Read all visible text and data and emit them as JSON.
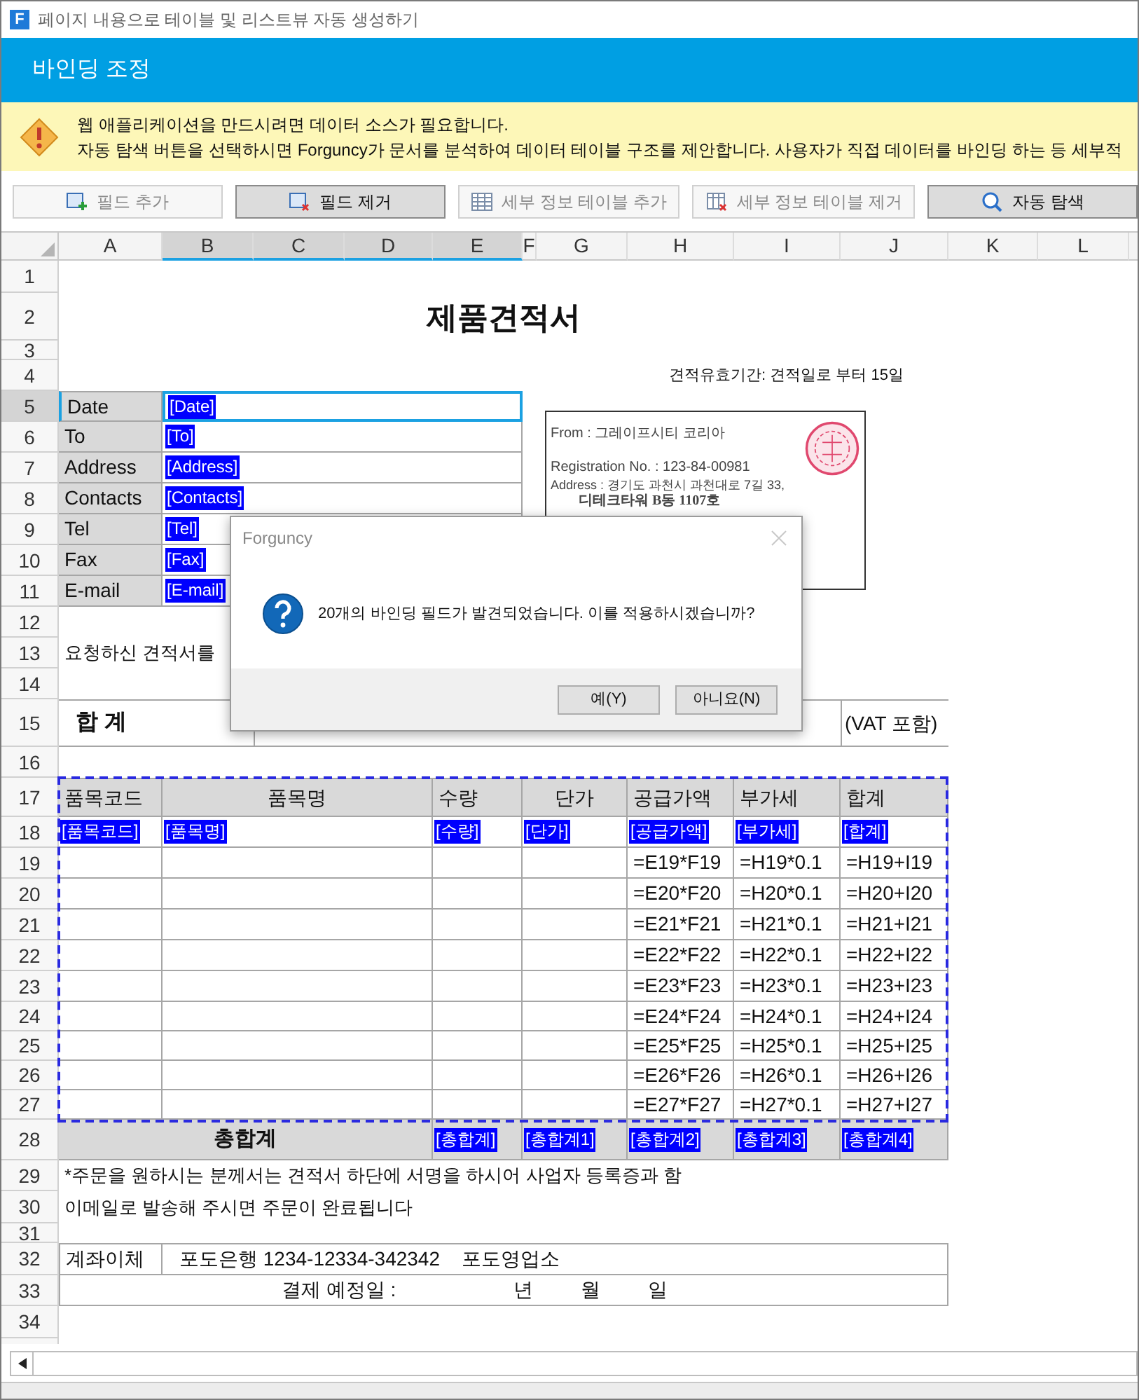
{
  "window": {
    "title": "페이지 내용으로 테이블 및 리스트뷰 자동 생성하기",
    "logo": "F"
  },
  "header": {
    "title": "바인딩 조정"
  },
  "warning": {
    "lines": [
      "웹 애플리케이션을 만드시려면 데이터 소스가 필요합니다.",
      "자동 탐색 버튼을 선택하시면 Forguncy가 문서를 분석하여 데이터 테이블 구조를 제안합니다. 사용자가 직접 데이터를 바인딩 하는 등 세부적"
    ]
  },
  "toolbar": [
    {
      "kind": "field-add",
      "label": "필드 추가",
      "disabled": true
    },
    {
      "kind": "field-remove",
      "label": "필드 제거",
      "disabled": false
    },
    {
      "kind": "table-add",
      "label": "세부 정보 테이블 추가",
      "disabled": true
    },
    {
      "kind": "table-remove",
      "label": "세부 정보 테이블 제거",
      "disabled": true
    },
    {
      "kind": "search",
      "label": "자동 탐색",
      "disabled": false
    }
  ],
  "columns": [
    {
      "label": "A",
      "selected": false
    },
    {
      "label": "B",
      "selected": true
    },
    {
      "label": "C",
      "selected": true
    },
    {
      "label": "D",
      "selected": true
    },
    {
      "label": "E",
      "selected": true
    },
    {
      "label": "F",
      "selected": false
    },
    {
      "label": "G",
      "selected": false
    },
    {
      "label": "H",
      "selected": false
    },
    {
      "label": "I",
      "selected": false
    },
    {
      "label": "J",
      "selected": false
    },
    {
      "label": "K",
      "selected": false
    },
    {
      "label": "L",
      "selected": false
    }
  ],
  "rows": [
    {
      "label": "1",
      "selected": false
    },
    {
      "label": "2",
      "selected": false
    },
    {
      "label": "3",
      "selected": false
    },
    {
      "label": "4",
      "selected": false
    },
    {
      "label": "5",
      "selected": true
    },
    {
      "label": "6",
      "selected": false
    },
    {
      "label": "7",
      "selected": false
    },
    {
      "label": "8",
      "selected": false
    },
    {
      "label": "9",
      "selected": false
    },
    {
      "label": "10",
      "selected": false
    },
    {
      "label": "11",
      "selected": false
    },
    {
      "label": "12",
      "selected": false
    },
    {
      "label": "13",
      "selected": false
    },
    {
      "label": "14",
      "selected": false
    },
    {
      "label": "15",
      "selected": false
    },
    {
      "label": "16",
      "selected": false
    },
    {
      "label": "17",
      "selected": false
    },
    {
      "label": "18",
      "selected": false
    },
    {
      "label": "19",
      "selected": false
    },
    {
      "label": "20",
      "selected": false
    },
    {
      "label": "21",
      "selected": false
    },
    {
      "label": "22",
      "selected": false
    },
    {
      "label": "23",
      "selected": false
    },
    {
      "label": "24",
      "selected": false
    },
    {
      "label": "25",
      "selected": false
    },
    {
      "label": "26",
      "selected": false
    },
    {
      "label": "27",
      "selected": false
    },
    {
      "label": "28",
      "selected": false
    },
    {
      "label": "29",
      "selected": false
    },
    {
      "label": "30",
      "selected": false
    },
    {
      "label": "31",
      "selected": false
    },
    {
      "label": "32",
      "selected": false
    },
    {
      "label": "33",
      "selected": false
    },
    {
      "label": "34",
      "selected": false
    }
  ],
  "sheet": {
    "title": "제품견적서",
    "validity": "견적유효기간: 견적일로 부터 15일",
    "info_fields": [
      {
        "label": "Date",
        "binding": "[Date]",
        "selected": true
      },
      {
        "label": "To",
        "binding": "[To]",
        "selected": false
      },
      {
        "label": "Address",
        "binding": "[Address]",
        "selected": false
      },
      {
        "label": "Contacts",
        "binding": "[Contacts]",
        "selected": false
      },
      {
        "label": "Tel",
        "binding": "[Tel]",
        "selected": false
      },
      {
        "label": "Fax",
        "binding": "[Fax]",
        "selected": false
      },
      {
        "label": "E-mail",
        "binding": "[E-mail]",
        "selected": false
      }
    ],
    "company_card": {
      "from": "From : 그레이프시티 코리아",
      "registration": "Registration No. : 123-84-00981",
      "address": "Address : 경기도 과천시 과천대로 7길 33,",
      "address_2": "디테크타워 B동 1107호"
    },
    "request_text": "요청하신 견적서를",
    "total_row": {
      "label": "합 계",
      "note": "(VAT 포함)"
    },
    "items_table": {
      "columns": [
        {
          "header": "품목코드",
          "binding": "[품목코드]"
        },
        {
          "header": "품목명",
          "binding": "[품목명]"
        },
        {
          "header": "수량",
          "binding": "[수량]"
        },
        {
          "header": "단가",
          "binding": "[단가]"
        },
        {
          "header": "공급가액",
          "binding": "[공급가액]"
        },
        {
          "header": "부가세",
          "binding": "[부가세]"
        },
        {
          "header": "합계",
          "binding": "[합계]"
        }
      ],
      "rows": [
        {
          "supply": "=E19*F19",
          "vat": "=H19*0.1",
          "total": "=H19+I19"
        },
        {
          "supply": "=E20*F20",
          "vat": "=H20*0.1",
          "total": "=H20+I20"
        },
        {
          "supply": "=E21*F21",
          "vat": "=H21*0.1",
          "total": "=H21+I21"
        },
        {
          "supply": "=E22*F22",
          "vat": "=H22*0.1",
          "total": "=H22+I22"
        },
        {
          "supply": "=E23*F23",
          "vat": "=H23*0.1",
          "total": "=H23+I23"
        },
        {
          "supply": "=E24*F24",
          "vat": "=H24*0.1",
          "total": "=H24+I24"
        },
        {
          "supply": "=E25*F25",
          "vat": "=H25*0.1",
          "total": "=H25+I25"
        },
        {
          "supply": "=E26*F26",
          "vat": "=H26*0.1",
          "total": "=H26+I26"
        },
        {
          "supply": "=E27*F27",
          "vat": "=H27*0.1",
          "total": "=H27+I27"
        }
      ],
      "grand_total": {
        "label": "총합계",
        "bindings": [
          "[총합계]",
          "[총합계1]",
          "[총합계2]",
          "[총합계3]",
          "[총합계4]"
        ]
      }
    },
    "notes": [
      "*주문을 원하시는 분께서는 견적서 하단에 서명을 하시어 사업자 등록증과 함",
      "이메일로 발송해 주시면 주문이 완료됩니다"
    ],
    "bank": {
      "label": "계좌이체",
      "text": "포도은행 1234-12334-342342    포도영업소"
    },
    "payment": {
      "label": "결제 예정일 :",
      "year": "년",
      "month": "월",
      "day": "일"
    }
  },
  "dialog": {
    "title": "Forguncy",
    "message": "20개의 바인딩 필드가 발견되었습니다. 이를 적용하시겠습니까?",
    "buttons": [
      "예(Y)",
      "아니요(N)"
    ]
  }
}
